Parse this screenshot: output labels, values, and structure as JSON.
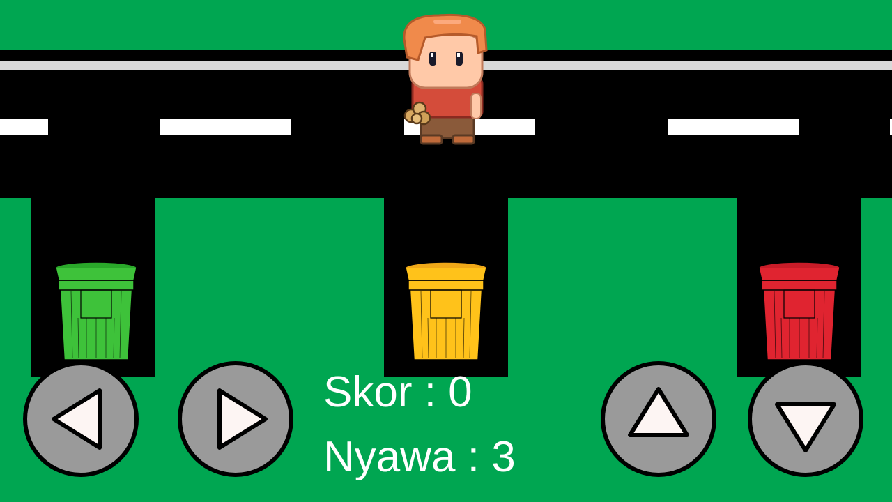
{
  "colors": {
    "grass": "#00a651",
    "road": "#000000",
    "curb": "#d9d9d9",
    "lane_marking": "#ffffff",
    "button_fill": "#9a9a9a",
    "arrow_fill": "#fdf5f3",
    "hud_text": "#ffffff"
  },
  "hud": {
    "score_label": "Skor",
    "score_value": "0",
    "score_text": "Skor : 0",
    "lives_label": "Nyawa",
    "lives_value": "3",
    "lives_text": "Nyawa : 3"
  },
  "bins": [
    {
      "color_name": "green",
      "fill": "#3ec23a",
      "rim": "#2aa82a"
    },
    {
      "color_name": "yellow",
      "fill": "#ffc21a",
      "rim": "#f0a818"
    },
    {
      "color_name": "red",
      "fill": "#e02430",
      "rim": "#c81c28"
    }
  ],
  "player": {
    "hair": "#f08a4b",
    "skin": "#ffc9a8",
    "shirt": "#d44c3a",
    "pants": "#8a5a3a",
    "held_item": "trash-paper-ball-icon"
  },
  "controls": [
    {
      "name": "left-button",
      "icon": "arrow-left-icon"
    },
    {
      "name": "right-button",
      "icon": "arrow-right-icon"
    },
    {
      "name": "up-button",
      "icon": "arrow-up-icon"
    },
    {
      "name": "down-button",
      "icon": "arrow-down-icon"
    }
  ]
}
